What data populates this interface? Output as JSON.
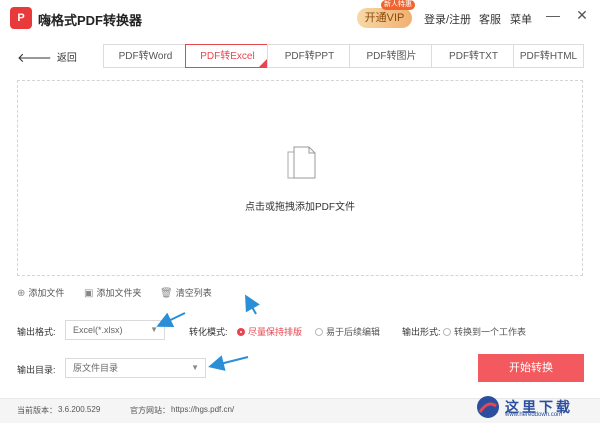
{
  "app": {
    "logo_letter": "P",
    "title": "嗨格式PDF转换器"
  },
  "header": {
    "vip_label": "开通VIP",
    "vip_badge": "新人特惠",
    "login_label": "登录/注册",
    "support_label": "客服",
    "menu_label": "菜单",
    "minimize_glyph": "—",
    "close_glyph": "✕"
  },
  "nav": {
    "back_label": "返回"
  },
  "tabs": [
    {
      "label": "PDF转Word"
    },
    {
      "label": "PDF转Excel",
      "active": true
    },
    {
      "label": "PDF转PPT"
    },
    {
      "label": "PDF转图片"
    },
    {
      "label": "PDF转TXT"
    },
    {
      "label": "PDF转HTML"
    }
  ],
  "dropzone": {
    "hint": "点击或拖拽添加PDF文件"
  },
  "file_actions": {
    "add_file": "添加文件",
    "add_folder": "添加文件夹",
    "clear_list": "清空列表"
  },
  "options": {
    "format_label": "输出格式:",
    "format_value": "Excel(*.xlsx)",
    "mode_label": "转化模式:",
    "mode_options": [
      "尽量保持排版",
      "易于后续编辑"
    ],
    "mode_selected": "尽量保持排版",
    "output_form_label": "输出形式:",
    "output_form_option": "转换到一个工作表",
    "dir_label": "输出目录:",
    "dir_value": "原文件目录"
  },
  "actions": {
    "start_label": "开始转换"
  },
  "footer": {
    "version_label": "当前版本：",
    "version": "3.6.200.529",
    "site_label": "官方网站：",
    "site": "https://hgs.pdf.cn/"
  },
  "watermark": {
    "text": "这里下载",
    "sub": "www.hereddown.com"
  },
  "colors": {
    "accent": "#e8464e",
    "arrow": "#2a8fd6",
    "vip": "#f0b070"
  }
}
